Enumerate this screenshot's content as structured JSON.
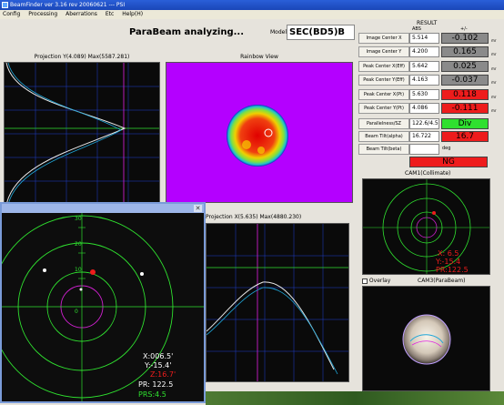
{
  "window": {
    "title": "BeamFinder ver 3.16 rev 20060621 --- PSI"
  },
  "menu": [
    "Config",
    "Processing",
    "Aberrations",
    "Etc",
    "Help(H)"
  ],
  "header": {
    "status": "ParaBeam analyzing...",
    "model_label": "Model",
    "model_value": "SEC(BD5)B"
  },
  "panels": {
    "projection_y_title": "Projection Y(4.089) Max(5587.281)",
    "rainbow_title": "Rainbow View",
    "projection_x_title": "Projection X(5.635) Max(4880.230)"
  },
  "result": {
    "title": "RESULT",
    "col_abs": "ABS",
    "col_delta": "+/-",
    "rows": [
      {
        "label": "Image Center X",
        "abs": "5.514",
        "delta": "-0.102",
        "status": "gray",
        "unit": "mr"
      },
      {
        "label": "Image Center Y",
        "abs": "4.200",
        "delta": "0.165",
        "status": "gray",
        "unit": "mr"
      },
      {
        "label": "Peak Center X(Eff)",
        "abs": "5.642",
        "delta": "0.025",
        "status": "gray",
        "unit": "mr"
      },
      {
        "label": "Peak Center Y(Eff)",
        "abs": "4.163",
        "delta": "-0.037",
        "status": "gray",
        "unit": "mr"
      },
      {
        "label": "Peak Center X(Pt)",
        "abs": "5.630",
        "delta": "0.118",
        "status": "red",
        "unit": "mr"
      },
      {
        "label": "Peak Center Y(Pt)",
        "abs": "4.086",
        "delta": "-0.111",
        "status": "red",
        "unit": "mr"
      }
    ],
    "parallelness_label": "Parallelness/SZ",
    "parallelness_value": "122.6/4.5",
    "parallelness_status": "Div",
    "tilt_alpha_label": "Beam Tilt(alpha)",
    "tilt_alpha_value": "16.722",
    "tilt_alpha_delta": "16.7",
    "tilt_beta_label": "Beam Tilt(beta)",
    "tilt_beta_unit": "deg",
    "verdict": "NG"
  },
  "cameras": {
    "cam1_title": "CAM1(Collimate)",
    "cam1_x": "X: 6.5",
    "cam1_y": "Y:-15.4",
    "cam1_pr": "PR:122.5",
    "overlay_label": "Overlay",
    "cam3_title": "CAM3(ParaBeam)"
  },
  "popup": {
    "axis_labels": [
      "30",
      "20",
      "10",
      "0"
    ],
    "x_text": "X:006.5'",
    "y_text": "Y:-15.4'",
    "z_text": "Z:16.7'",
    "pr_text": "PR: 122.5",
    "prs_text": "PRS:4.5"
  },
  "colors": {
    "status_gray": "#8a8a8a",
    "status_red": "#ee1c1c",
    "status_green": "#2fe02f",
    "rainbow_bg": "#b400ff"
  }
}
